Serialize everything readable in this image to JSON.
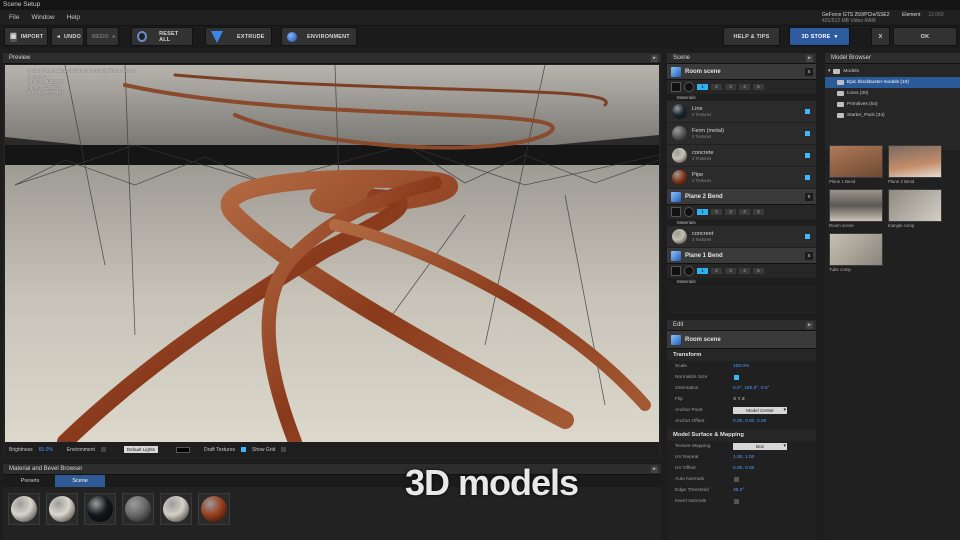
{
  "window": {
    "title": "Scene Setup"
  },
  "menu": {
    "items": [
      "File",
      "Window",
      "Help"
    ]
  },
  "gpu": {
    "name": "GeForce GTS 250/PCIe/SSE2",
    "memory": "431/512 MB Video RAM"
  },
  "element": {
    "label": "Element",
    "value": "12,069"
  },
  "toolbar": {
    "import": "IMPORT",
    "undo": "UNDO",
    "redo": "REDO",
    "reset_all": "RESET ALL",
    "extrude": "EXTRUDE",
    "environment": "ENVIRONMENT",
    "help_tips": "HELP & TIPS",
    "store": "3D STORE",
    "close": "X",
    "ok": "OK"
  },
  "preview": {
    "title": "Preview",
    "info": [
      "Model: Models/Epic blockbuster models/Room scene",
      "Meshes: 4",
      "Vertices: 342,226",
      "Faces: 402,800",
      "Size: 1.3, 0.7, 1.0"
    ],
    "brightness_label": "Brightness",
    "brightness_value": "65.0%",
    "environment_label": "Environment",
    "lights_value": "Default Lights",
    "draft_label": "Draft Textures",
    "grid_label": "Show Grid"
  },
  "material_browser": {
    "title": "Material and Bevel Browser",
    "tabs": [
      "Presets",
      "Scene"
    ],
    "active_tab": "Scene",
    "swatches": [
      "#d8d4cc",
      "#dcd7cd",
      "#14181c",
      "#6a6a6a",
      "#d4d0c7",
      "#9a4020"
    ]
  },
  "overlay": {
    "caption": "3D models"
  },
  "scene": {
    "title": "Scene",
    "materials_label": "Materials",
    "levels": [
      "1",
      "2",
      "3",
      "4",
      "5"
    ],
    "groups": [
      {
        "name": "Room scene",
        "materials": [
          {
            "name": "Line",
            "sub": "0 Textures",
            "color": "#1d2a33"
          },
          {
            "name": "Ferm (metal)",
            "sub": "0 Textures",
            "color": "#5a5a5a"
          },
          {
            "name": "concrete",
            "sub": "4 Textures",
            "color": "#c9c3b6"
          },
          {
            "name": "Pipe",
            "sub": "4 Textures",
            "color": "#8a3c1c"
          }
        ]
      },
      {
        "name": "Plane 2 Bend",
        "materials": [
          {
            "name": "concreet",
            "sub": "4 Textures",
            "color": "#c4bfb2"
          }
        ]
      },
      {
        "name": "Plane 1 Bend",
        "materials": []
      }
    ]
  },
  "edit": {
    "title": "Edit",
    "object": "Room scene",
    "transform_title": "Transform",
    "rows": [
      {
        "label": "Scale",
        "value": "100.0%"
      },
      {
        "label": "Normalize Size",
        "value": ""
      },
      {
        "label": "Orientation",
        "value": "0.0°, 180.0°, 0.0°"
      },
      {
        "label": "Flip",
        "value": "X  Y  Z"
      },
      {
        "label": "Anchor Point",
        "value": "Model Center"
      },
      {
        "label": "Anchor Offset",
        "value": "0.00, 0.00, 0.00"
      }
    ],
    "surface_title": "Model Surface & Mapping",
    "surface_rows": [
      {
        "label": "Texture Mapping",
        "value": "Box"
      },
      {
        "label": "UV Repeat",
        "value": "1.00, 1.00"
      },
      {
        "label": "UV Offset",
        "value": "0.00, 0.00"
      },
      {
        "label": "Auto Normals",
        "value": ""
      },
      {
        "label": "Edge Threshold",
        "value": "35.0°"
      },
      {
        "label": "Invert Normals",
        "value": ""
      }
    ]
  },
  "model_browser": {
    "title": "Model Browser",
    "tree": [
      "Models",
      "Epic blockbuster models (10)",
      "Icons (30)",
      "Primitives (54)",
      "Starter_Pack (34)"
    ],
    "thumbs": [
      "Plane 1 Bend",
      "Plane 2 Bend",
      "Room scene",
      "triangle comp",
      "Tube comp"
    ]
  }
}
